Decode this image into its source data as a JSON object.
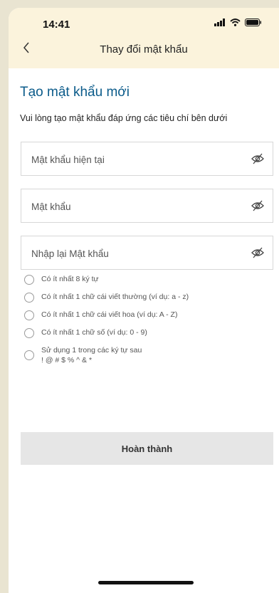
{
  "status_bar": {
    "time": "14:41"
  },
  "header": {
    "title": "Thay đổi mật khẩu",
    "back_icon": "chevron-left"
  },
  "form": {
    "heading": "Tạo mật khẩu mới",
    "subtitle": "Vui lòng tạo mật khẩu đáp ứng các tiêu chí bên dưới",
    "fields": [
      {
        "placeholder": "Mật khẩu hiện tại",
        "value": ""
      },
      {
        "placeholder": "Mật khẩu",
        "value": ""
      },
      {
        "placeholder": "Nhập lại Mật khẩu",
        "value": ""
      }
    ],
    "criteria": [
      {
        "text": "Có ít nhất 8 ký tự"
      },
      {
        "text": "Có ít nhất 1 chữ cái viết thường (ví dụ: a - z)"
      },
      {
        "text": "Có ít nhất 1 chữ cái viết hoa (ví dụ: A - Z)"
      },
      {
        "text": "Có ít nhất 1 chữ số (ví dụ: 0 - 9)"
      },
      {
        "text": "Sử dụng 1 trong các ký tự sau",
        "text2": "! @ # $ % ^ & *"
      }
    ],
    "submit_label": "Hoàn thành"
  }
}
